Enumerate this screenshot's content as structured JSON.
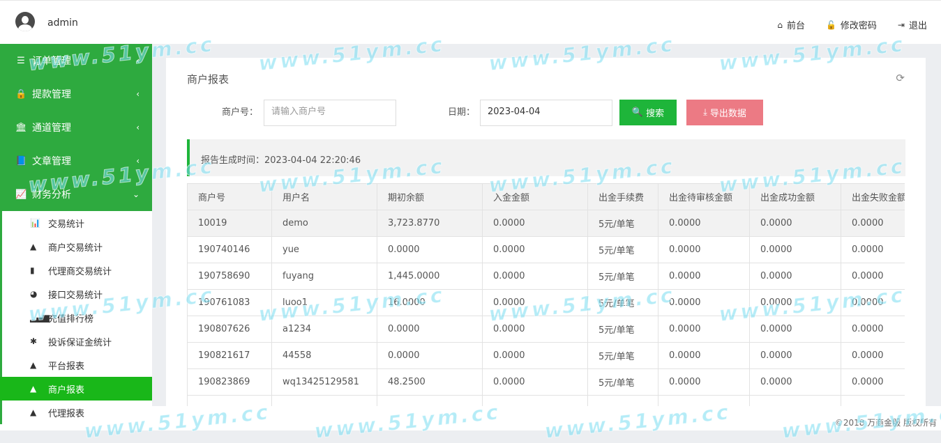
{
  "header": {
    "username": "admin",
    "links": [
      {
        "icon": "home-icon",
        "glyph": "⌂",
        "label": "前台"
      },
      {
        "icon": "lock-icon",
        "glyph": "🔓",
        "label": "修改密码"
      },
      {
        "icon": "logout-icon",
        "glyph": "⇥",
        "label": "退出"
      }
    ]
  },
  "sidebar": {
    "groups": [
      {
        "label": "订单管理",
        "glyph": "☰",
        "chevron": "‹"
      },
      {
        "label": "提款管理",
        "glyph": "🔒",
        "chevron": "‹"
      },
      {
        "label": "通道管理",
        "glyph": "🏛",
        "chevron": "‹"
      },
      {
        "label": "文章管理",
        "glyph": "📘",
        "chevron": "‹"
      },
      {
        "label": "财务分析",
        "glyph": "📈",
        "chevron": "⌄"
      }
    ],
    "sub_items": [
      {
        "label": "交易统计",
        "glyph": "📊"
      },
      {
        "label": "商户交易统计",
        "glyph": "▲"
      },
      {
        "label": "代理商交易统计",
        "glyph": "▮"
      },
      {
        "label": "接口交易统计",
        "glyph": "◕"
      },
      {
        "label": "充值排行榜",
        "glyph": "▂▄▆"
      },
      {
        "label": "投诉保证金统计",
        "glyph": "✱"
      },
      {
        "label": "平台报表",
        "glyph": "▲"
      },
      {
        "label": "商户报表",
        "glyph": "▲"
      },
      {
        "label": "代理报表",
        "glyph": "▲"
      }
    ]
  },
  "main": {
    "title": "商户报表",
    "merchant_label": "商户号：",
    "merchant_placeholder": "请输入商户号",
    "date_label": "日期：",
    "date_value": "2023-04-04",
    "search_label": "搜索",
    "export_label": "导出数据",
    "report_label": "报告生成时间：",
    "report_time": "2023-04-04 22:20:46"
  },
  "table": {
    "columns": [
      "商户号",
      "用户名",
      "期初余额",
      "入金金额",
      "出金手续费",
      "出金待审核金额",
      "出金成功金额",
      "出金失败金额"
    ],
    "rows": [
      [
        "10019",
        "demo",
        "3,723.8770",
        "0.0000",
        "5元/单笔",
        "0.0000",
        "0.0000",
        "0.0000"
      ],
      [
        "190740146",
        "yue",
        "0.0000",
        "0.0000",
        "5元/单笔",
        "0.0000",
        "0.0000",
        "0.0000"
      ],
      [
        "190758690",
        "fuyang",
        "1,445.0000",
        "0.0000",
        "5元/单笔",
        "0.0000",
        "0.0000",
        "0.0000"
      ],
      [
        "190761083",
        "luoo1",
        "16.0000",
        "0.0000",
        "5元/单笔",
        "0.0000",
        "0.0000",
        "0.0000"
      ],
      [
        "190807626",
        "a1234",
        "0.0000",
        "0.0000",
        "5元/单笔",
        "0.0000",
        "0.0000",
        "0.0000"
      ],
      [
        "190821617",
        "44558",
        "0.0000",
        "0.0000",
        "5元/单笔",
        "0.0000",
        "0.0000",
        "0.0000"
      ],
      [
        "190823869",
        "wq13425129581",
        "48.2500",
        "0.0000",
        "5元/单笔",
        "0.0000",
        "0.0000",
        "0.0000"
      ],
      [
        "",
        "",
        "",
        "",
        "",
        "",
        "",
        ""
      ]
    ]
  },
  "footer": {
    "copyright": "©2018 万商金服 版权所有"
  },
  "watermark": "www.51ym.cc",
  "colors": {
    "sidebar_green": "#2eaa3f",
    "active_green": "#19b719",
    "search_button": "#1eb53a",
    "export_button": "#ec7a84"
  }
}
